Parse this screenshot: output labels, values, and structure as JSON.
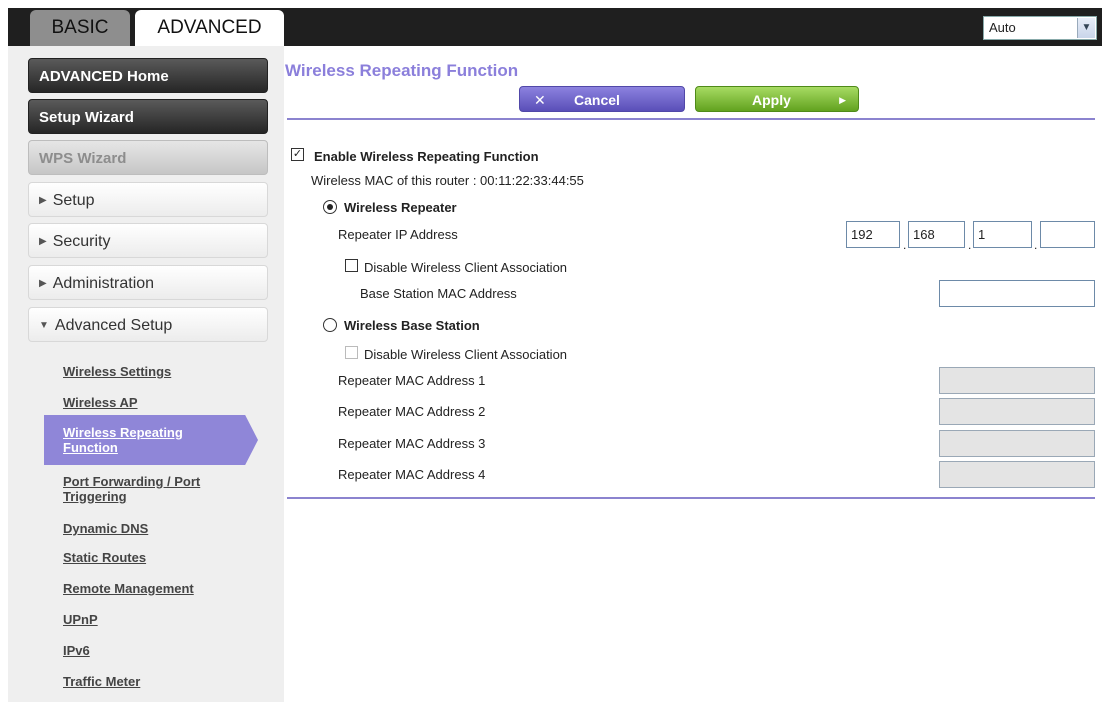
{
  "tabs": [
    {
      "label": "BASIC",
      "active": false
    },
    {
      "label": "ADVANCED",
      "active": true
    }
  ],
  "language_select": {
    "value": "Auto"
  },
  "sidebar": {
    "advanced_home": "ADVANCED Home",
    "setup_wizard": "Setup Wizard",
    "wps_wizard": "WPS Wizard",
    "sections": [
      {
        "label": "Setup",
        "expanded": false
      },
      {
        "label": "Security",
        "expanded": false
      },
      {
        "label": "Administration",
        "expanded": false
      },
      {
        "label": "Advanced Setup",
        "expanded": true
      }
    ],
    "sub_items": [
      "Wireless Settings",
      "Wireless AP",
      "Wireless Repeating Function",
      "Port Forwarding / Port Triggering",
      "Dynamic DNS",
      "Static Routes",
      "Remote Management",
      "UPnP",
      "IPv6",
      "Traffic Meter"
    ],
    "active_item": "Wireless Repeating Function"
  },
  "page": {
    "title": "Wireless Repeating Function",
    "cancel_label": "Cancel",
    "apply_label": "Apply"
  },
  "form": {
    "enable_label": "Enable Wireless Repeating Function",
    "enable_checked": true,
    "mac_info": "Wireless MAC of this router : 00:11:22:33:44:55",
    "repeater_radio_label": "Wireless Repeater",
    "repeater_selected": true,
    "repeater_ip_label": "Repeater IP Address",
    "repeater_ip": [
      "192",
      "168",
      "1",
      ""
    ],
    "disable_assoc_label": "Disable Wireless Client Association",
    "base_station_mac_label": "Base Station MAC Address",
    "base_station_radio_label": "Wireless Base Station",
    "base_station_selected": false,
    "disable_assoc_label_2": "Disable Wireless Client Association",
    "repeater_mac_labels": [
      "Repeater MAC Address 1",
      "Repeater MAC Address 2",
      "Repeater MAC Address 3",
      "Repeater MAC Address 4"
    ]
  },
  "icons": {
    "cancel": "close-icon",
    "apply": "arrow-right-icon",
    "dropdown": "chevron-down-icon",
    "section": "triangle-right-icon"
  },
  "colors": {
    "accent_purple": "#8b7fdb",
    "apply_green": "#6aa82a",
    "topbar": "#1f1f1f"
  }
}
